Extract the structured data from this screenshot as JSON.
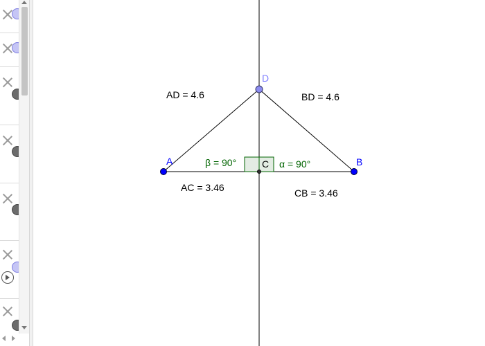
{
  "algebra": {
    "rows": [
      {
        "object": "row-1",
        "shown": true
      },
      {
        "object": "row-2",
        "shown": true
      },
      {
        "object": "row-3",
        "shown": false
      },
      {
        "object": "row-4",
        "shown": false
      },
      {
        "object": "row-5",
        "shown": false
      },
      {
        "object": "row-6",
        "shown": true
      },
      {
        "object": "row-7",
        "shown": false
      }
    ]
  },
  "points": {
    "A": {
      "label": "A",
      "color": "#0000ff"
    },
    "B": {
      "label": "B",
      "color": "#0000ff"
    },
    "C": {
      "label": "C",
      "color": "#000000"
    },
    "D": {
      "label": "D",
      "color": "#7f7fff"
    }
  },
  "measurements": {
    "AD": "AD = 4.6",
    "BD": "BD = 4.6",
    "AC": "AC = 3.46",
    "CB": "CB = 3.46"
  },
  "angles": {
    "beta": "β = 90°",
    "alpha": "α = 90°",
    "color": "#006400"
  },
  "colors": {
    "point_fill": "#0000ff",
    "point_d_fill": "#8080ff",
    "segment": "#000000",
    "angle_fill": "#e6f0e6",
    "angle_stroke": "#006400"
  }
}
